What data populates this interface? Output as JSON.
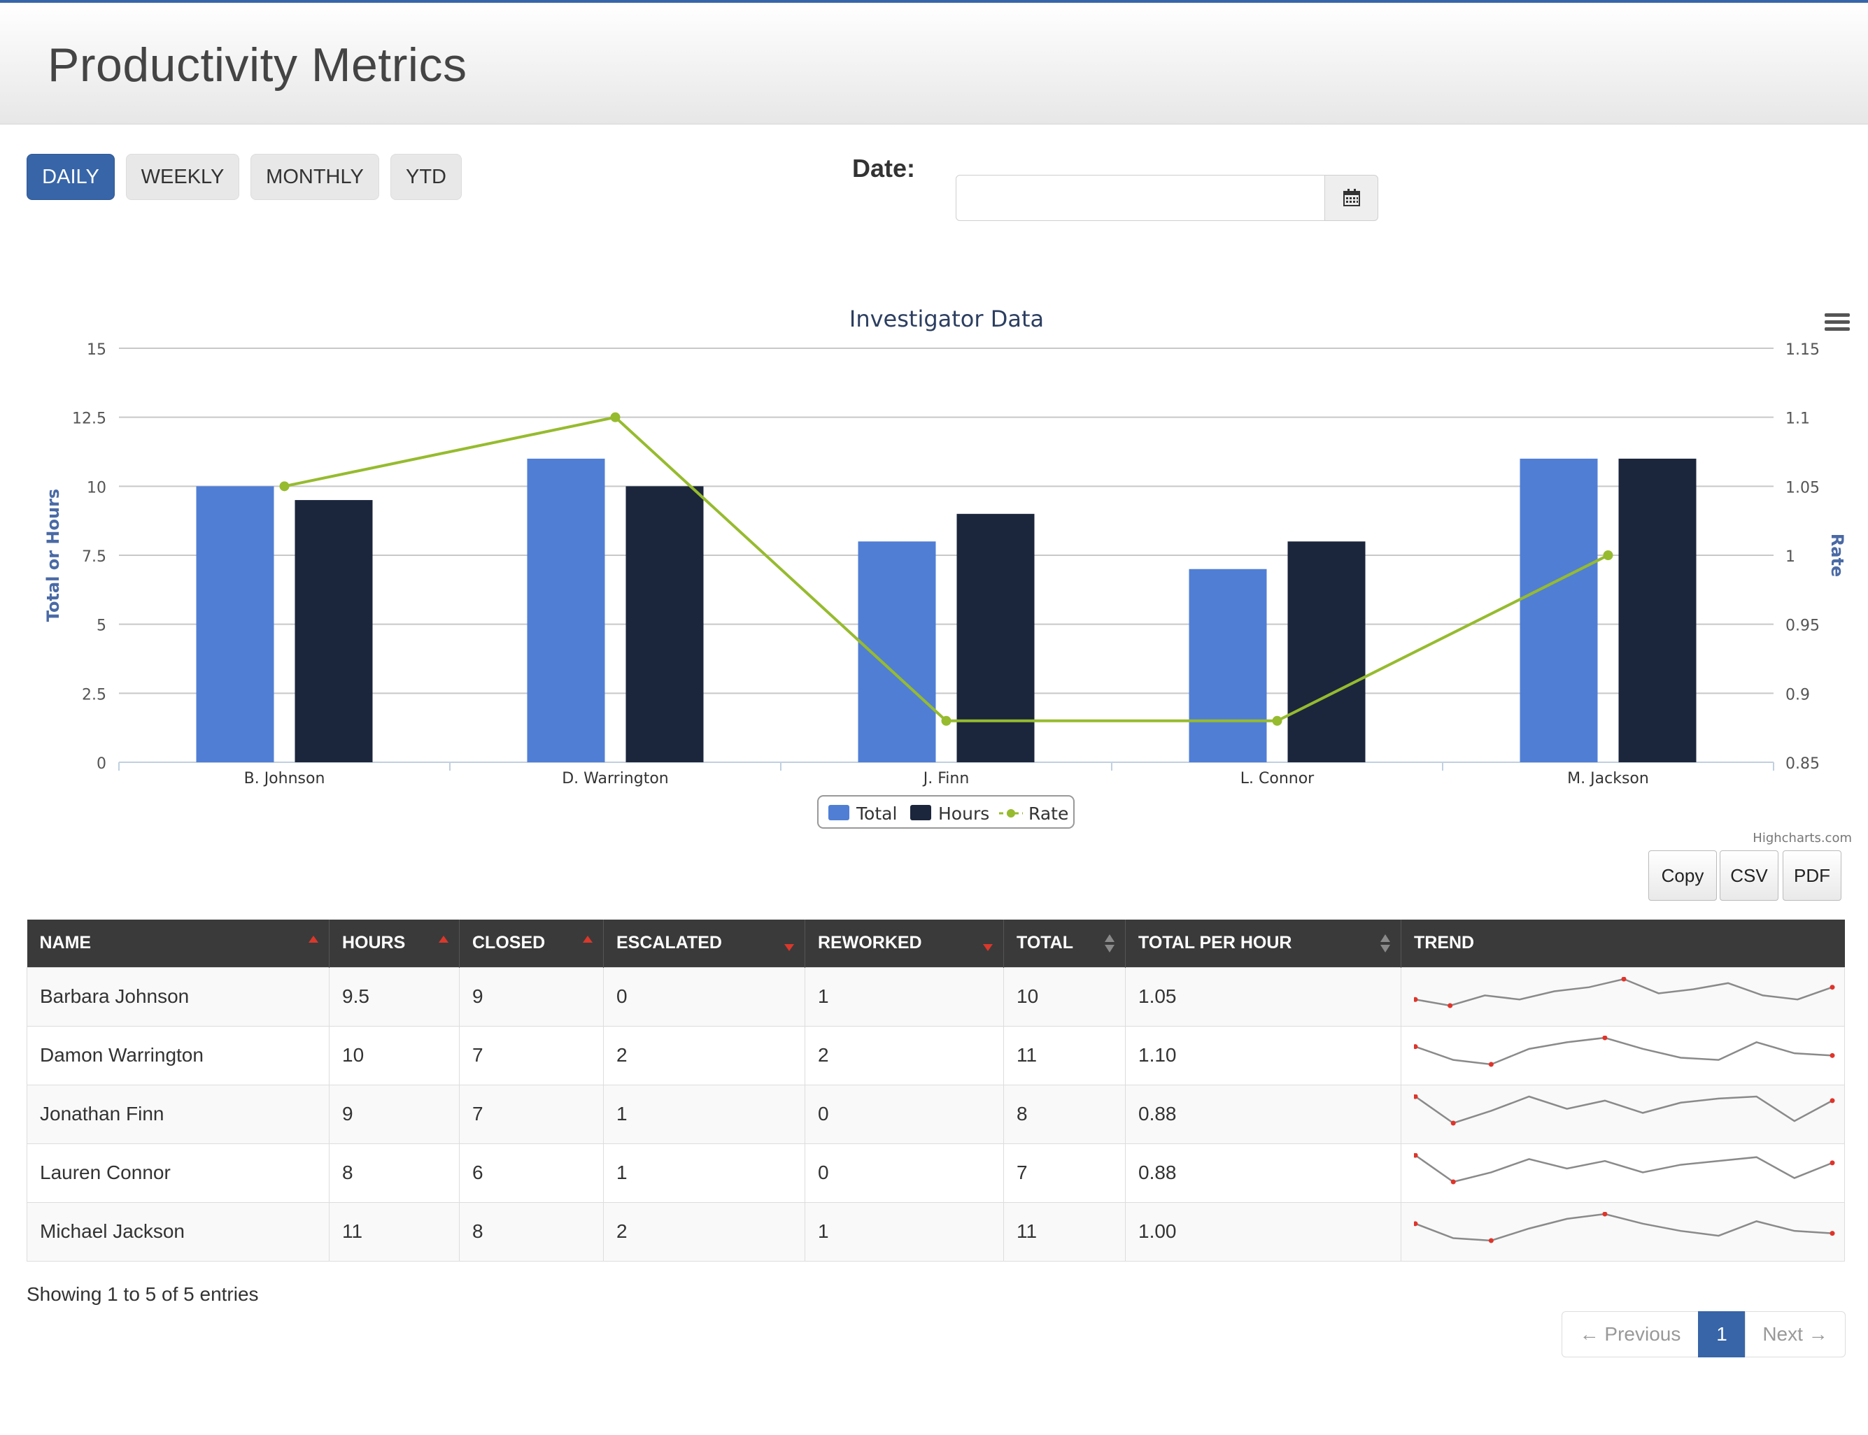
{
  "header": {
    "title": "Productivity Metrics"
  },
  "periods": [
    "DAILY",
    "WEEKLY",
    "MONTHLY",
    "YTD"
  ],
  "date": {
    "label": "Date:",
    "value": "",
    "placeholder": ""
  },
  "chart_data": {
    "type": "bar",
    "title": "Investigator Data",
    "categories": [
      "B. Johnson",
      "D. Warrington",
      "J. Finn",
      "L. Connor",
      "M. Jackson"
    ],
    "series": [
      {
        "name": "Total",
        "type": "bar",
        "axis": "left",
        "color": "#507ed5",
        "values": [
          10,
          11,
          8,
          7,
          11
        ]
      },
      {
        "name": "Hours",
        "type": "bar",
        "axis": "left",
        "color": "#1b263c",
        "values": [
          9.5,
          10,
          9,
          8,
          11
        ]
      },
      {
        "name": "Rate",
        "type": "line",
        "axis": "right",
        "color": "#96bb2e",
        "values": [
          1.05,
          1.1,
          0.88,
          0.88,
          1.0
        ]
      }
    ],
    "ylabel": "Total or Hours",
    "ylim": [
      0,
      15
    ],
    "yticks": [
      "0",
      "2.5",
      "5",
      "7.5",
      "10",
      "12.5",
      "15"
    ],
    "y2label": "Rate",
    "y2lim": [
      0.85,
      1.15
    ],
    "y2ticks": [
      "0.85",
      "0.9",
      "0.95",
      "1",
      "1.05",
      "1.1",
      "1.15"
    ],
    "grid": true,
    "legend": "bottom-center",
    "credits": "Highcharts.com"
  },
  "export": {
    "copy": "Copy",
    "csv": "CSV",
    "pdf": "PDF"
  },
  "table": {
    "columns": [
      "NAME",
      "HOURS",
      "CLOSED",
      "ESCALATED",
      "REWORKED",
      "TOTAL",
      "TOTAL PER HOUR",
      "TREND"
    ],
    "rows": [
      {
        "name": "Barbara Johnson",
        "hours": "9.5",
        "closed": "9",
        "escalated": "0",
        "reworked": "1",
        "total": "10",
        "tph": "1.05",
        "trend": [
          3,
          1.5,
          4,
          3,
          5,
          6,
          8,
          4.5,
          5.5,
          7,
          4,
          3,
          6
        ]
      },
      {
        "name": "Damon Warrington",
        "hours": "10",
        "closed": "7",
        "escalated": "2",
        "reworked": "2",
        "total": "11",
        "tph": "1.10",
        "trend": [
          7,
          4,
          3,
          6.5,
          8,
          9,
          6.5,
          4.5,
          4,
          8,
          5.5,
          5
        ]
      },
      {
        "name": "Jonathan Finn",
        "hours": "9",
        "closed": "7",
        "escalated": "1",
        "reworked": "0",
        "total": "8",
        "tph": "0.88",
        "trend": [
          9,
          2.5,
          5.5,
          9,
          6,
          8,
          5,
          7.5,
          8.5,
          9,
          3,
          8
        ]
      },
      {
        "name": "Lauren Connor",
        "hours": "8",
        "closed": "6",
        "escalated": "1",
        "reworked": "0",
        "total": "7",
        "tph": "0.88",
        "trend": [
          9,
          2,
          4.5,
          8,
          5.5,
          7.5,
          4.5,
          6.5,
          7.5,
          8.5,
          3,
          7
        ]
      },
      {
        "name": "Michael Jackson",
        "hours": "11",
        "closed": "8",
        "escalated": "2",
        "reworked": "1",
        "total": "11",
        "tph": "1.00",
        "trend": [
          6,
          3,
          2.5,
          5,
          7,
          8,
          6,
          4.5,
          3.5,
          6.5,
          4.5,
          4
        ]
      }
    ]
  },
  "info": "Showing 1 to 5 of 5 entries",
  "pagination": {
    "prev": "← Previous",
    "page": "1",
    "next": "Next →"
  }
}
